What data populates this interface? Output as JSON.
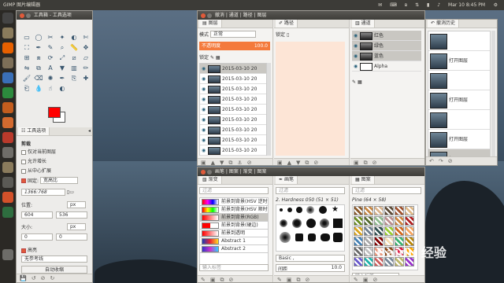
{
  "top_bar": {
    "app_title": "GIMP 图片编辑器",
    "time": "Mar 10 8:45 PM",
    "tray_icons": [
      "mail-icon",
      "keyboard-icon",
      "bluetooth-icon",
      "network-icon",
      "battery-icon",
      "volume-icon",
      "settings-gear-icon"
    ]
  },
  "toolbox": {
    "title": "工具箱 - 工具选项",
    "tools": [
      "rect-select",
      "ellipse-select",
      "free-select",
      "fuzzy-select",
      "color-select",
      "scissors",
      "foreground-select",
      "paths",
      "color-picker",
      "zoom",
      "measure",
      "move",
      "align",
      "crop",
      "rotate",
      "scale",
      "shear",
      "perspective",
      "flip",
      "cage",
      "text",
      "bucket-fill",
      "blend",
      "pencil",
      "paintbrush",
      "eraser",
      "airbrush",
      "ink",
      "clone",
      "heal",
      "perspective-clone",
      "blur",
      "smudge",
      "dodge-burn"
    ],
    "fg_color": "#ff0000",
    "bg_color": "#ffffff",
    "tab_label": "工具选项",
    "options_title": "剪裁",
    "opt1": "仅对当前图层",
    "opt2": "允许增长",
    "opt3": "从中心扩展",
    "fixed_label": "固定:",
    "fixed_value": "宽高比",
    "ratio_value": "1366:768",
    "position_label": "位置:",
    "pos_unit": "px",
    "pos_x": "604",
    "pos_y": "536",
    "size_label": "大小:",
    "size_unit": "px",
    "size_w": "0",
    "size_h": "0",
    "highlight_label": "高亮",
    "guides_value": "无参考线",
    "auto_shrink": "自动收缩"
  },
  "layers": {
    "tabs": [
      "撤消",
      "通道",
      "路径",
      "图层"
    ],
    "mode_label": "模式",
    "mode_value": "正常",
    "opacity_label": "不透明度",
    "opacity_value": "100.0",
    "lock_label": "锁定",
    "rows": [
      "2015-03-10 20",
      "2015-03-10 20",
      "2015-03-10 20",
      "2015-03-10 20",
      "2015-03-10 20",
      "2015-03-10 20",
      "2015-03-10 20",
      "2015-03-10 20",
      "2015-03-10 20"
    ]
  },
  "paths": {
    "title": "路径",
    "lock_label": "锁定"
  },
  "channels": {
    "title": "通道",
    "rows": [
      "红色",
      "绿色",
      "蓝色",
      "Alpha"
    ]
  },
  "undo": {
    "title": "撤消历史",
    "rows": [
      "",
      "打开图层",
      "",
      "打开图层",
      "",
      "打开图层",
      "打开图层"
    ]
  },
  "brushes_dock": {
    "title": "画笔 | 图案 | 渐变 | 图案",
    "grad_tab": "渐变",
    "grad_filter": "过滤",
    "gradients": [
      "前景到背景(HSV 逆时针)",
      "前景到背景(HSV 顺时针)",
      "前景到背景(RGB)",
      "前景到背景(硬边)",
      "前景到透明",
      "Abstract 1",
      "Abstract 2"
    ],
    "brush_tab": "画笔",
    "brush_filter": "过滤",
    "brush_name": "2. Hardness 050 (51 × 51)",
    "brush_preset": "Basic ,",
    "brush_spacing_label": "间距",
    "brush_spacing": "10.0",
    "pattern_tab": "图案",
    "pattern_filter": "过滤",
    "pattern_name": "Pine (64 × 58)",
    "tag_placeholder": "输入标签",
    "watermark": "Baidu 经验"
  },
  "colors": {
    "accent": "#f47a3c",
    "selection": "#c9c7c2",
    "opacity_bar": "#f47a3c",
    "panel_bg": "#fde5d6"
  }
}
